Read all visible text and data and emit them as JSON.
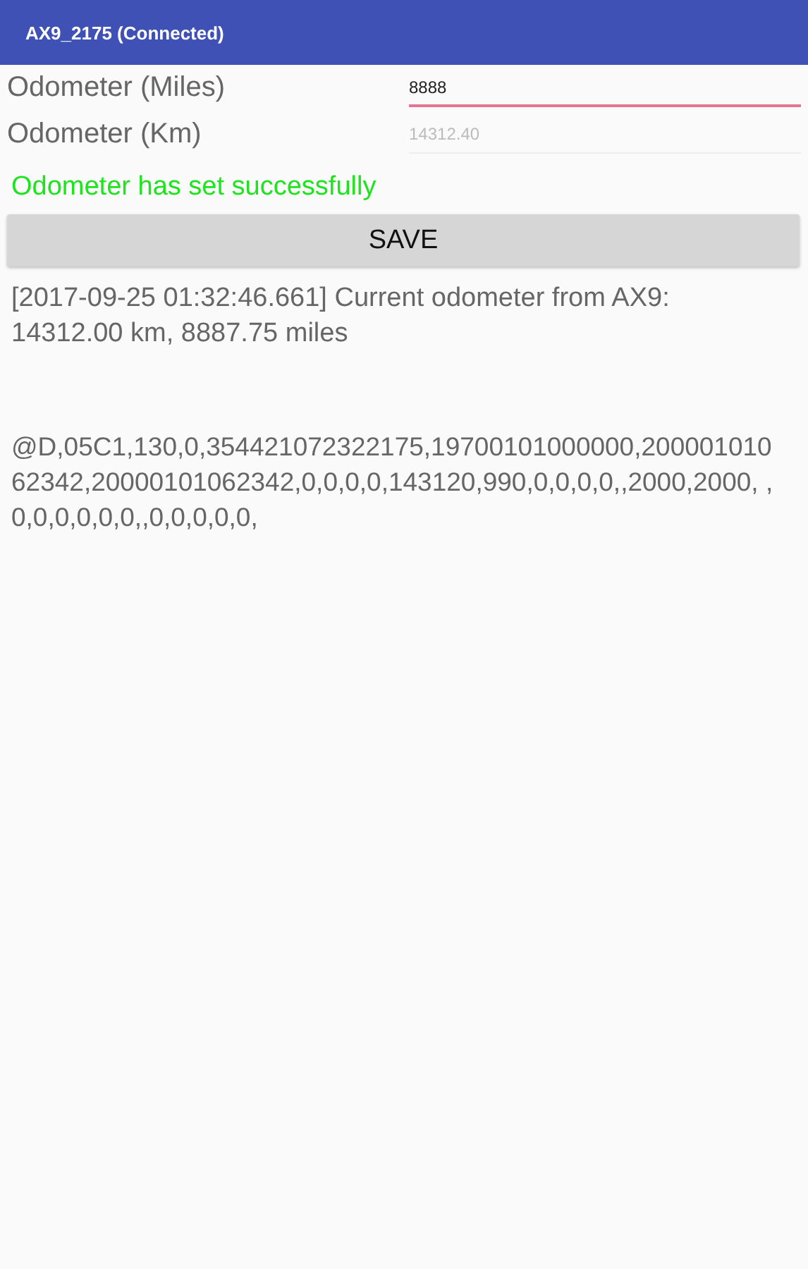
{
  "app_bar": {
    "title": "AX9_2175 (Connected)"
  },
  "fields": [
    {
      "label": "Odometer (Miles)",
      "value": "8888",
      "focused": true,
      "disabled": false
    },
    {
      "label": "Odometer (Km)",
      "value": "14312.40",
      "focused": false,
      "disabled": true
    }
  ],
  "status_message": "Odometer has set successfully",
  "save_button": "SAVE",
  "log": [
    "[2017-09-25 01:32:46.661] Current odometer from AX9: 14312.00 km, 8887.75 miles",
    "@D,05C1,130,0,354421072322175,19700101000000,20000101062342,20000101062342,0,0,0,0,143120,990,0,0,0,0,,2000,2000, ,0,0,0,0,0,0,,0,0,0,0,0,"
  ]
}
